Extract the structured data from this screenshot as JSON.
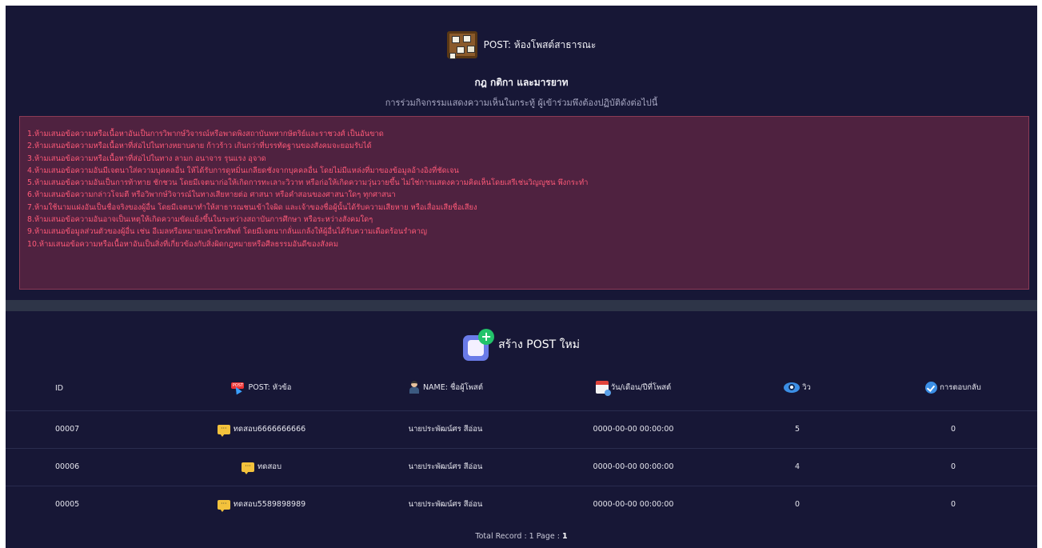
{
  "header": {
    "title": "POST: ห้องโพสต์สาธารณะ",
    "icon": "bulletin-board-icon"
  },
  "rules": {
    "title": "กฎ กติกา และมารยาท",
    "subtitle": "การร่วมกิจกรรมแสดงความเห็นในกระทู้ ผู้เข้าร่วมพึงต้องปฏิบัติดังต่อไปนี้",
    "items": [
      "1.ห้ามเสนอข้อความหรือเนื้อหาอันเป็นการวิพากษ์วิจารณ์หรือพาดพิงสถาบันพหากษัตริย์และราชวงศ์ เป็นอันขาด",
      "2.ห้ามเสนอข้อความหรือเนื้อหาที่ส่อไปในทางหยาบคาย ก้าวร้าว เกินกว่าที่บรรทัดฐานของสังคมจะยอมรับได้",
      "3.ห้ามเสนอข้อความหรือเนื้อหาที่ส่อไปในทาง ลามก อนาจาร รุนแรง อุจาด",
      "4.ห้ามเสนอข้อความอันมีเจตนาใส่ความบุคคลอื่น ให้ได้รับการดูหมิ่นเกลียดชังจากบุคคลอื่น โดยไม่มีแหล่งที่มาของข้อมูลอ้างอิงที่ชัดเจน",
      "5.ห้ามเสนอข้อความอันเป็นการท้าทาย ชักชวน โดยมีเจตนาก่อให้เกิดการทะเลาะวิวาท หรือก่อให้เกิดความวุ่นวายขึ้น ไม่ใช่การแสดงความคิดเห็นโดยเสรีเช่นวิญญูชน พึงกระทำ",
      "6.ห้ามเสนอข้อความกล่าวโจมตี หรือวิพากษ์วิจารณ์ในทางเสียหายต่อ ศาสนา หรือคำสอนของศาสนาใดๆ ทุกศาสนา",
      "7.ห้ามใช้นามแฝงอันเป็นชื่อจริงของผู้อื่น โดยมีเจตนาทำให้สาธารณชนเข้าใจผิด และเจ้าของชื่อผู้นั้นได้รับความเสียหาย หรือเสื่อมเสียชื่อเสียง",
      "8.ห้ามเสนอข้อความอันอาจเป็นเหตุให้เกิดความขัดแย้งขึ้นในระหว่างสถาบันการศึกษา หรือระหว่างสังคมใดๆ",
      "9.ห้ามเสนอข้อมูลส่วนตัวของผู้อื่น เช่น อีเมลหรือหมายเลขโทรศัพท์ โดยมีเจตนากลั่นแกล้งให้ผู้อื่นได้รับความเดือดร้อนรำคาญ",
      "10.ห้ามเสนอข้อความหรือเนื้อหาอันเป็นสิ่งที่เกี่ยวข้องกับสิ่งผิดกฎหมายหรือศีลธรรมอันดีของสังคม"
    ]
  },
  "create_post": {
    "label": "สร้าง POST ใหม่",
    "icon": "create-post-icon"
  },
  "table": {
    "headers": {
      "id": "ID",
      "title": "POST: หัวข้อ",
      "name": "NAME: ชื่อผู้โพสต์",
      "date": "วัน/เดือน/ปีที่โพสต์",
      "views": "วิว",
      "replies": "การตอบกลับ"
    },
    "rows": [
      {
        "id": "00007",
        "title": "ทดสอบ6666666666",
        "name": "นายประพัฒน์ศร สีอ่อน",
        "date": "0000-00-00 00:00:00",
        "views": "5",
        "replies": "0"
      },
      {
        "id": "00006",
        "title": "ทดสอบ",
        "name": "นายประพัฒน์ศร สีอ่อน",
        "date": "0000-00-00 00:00:00",
        "views": "4",
        "replies": "0"
      },
      {
        "id": "00005",
        "title": "ทดสอบ5589898989",
        "name": "นายประพัฒน์ศร สีอ่อน",
        "date": "0000-00-00 00:00:00",
        "views": "0",
        "replies": "0"
      }
    ]
  },
  "footer": {
    "prefix": "Total Record : 1 Page : ",
    "page": "1"
  },
  "colors": {
    "background": "#161634",
    "rules_box": "#4f2240",
    "rules_text": "#ff5a78",
    "separator": "#2e3548"
  }
}
